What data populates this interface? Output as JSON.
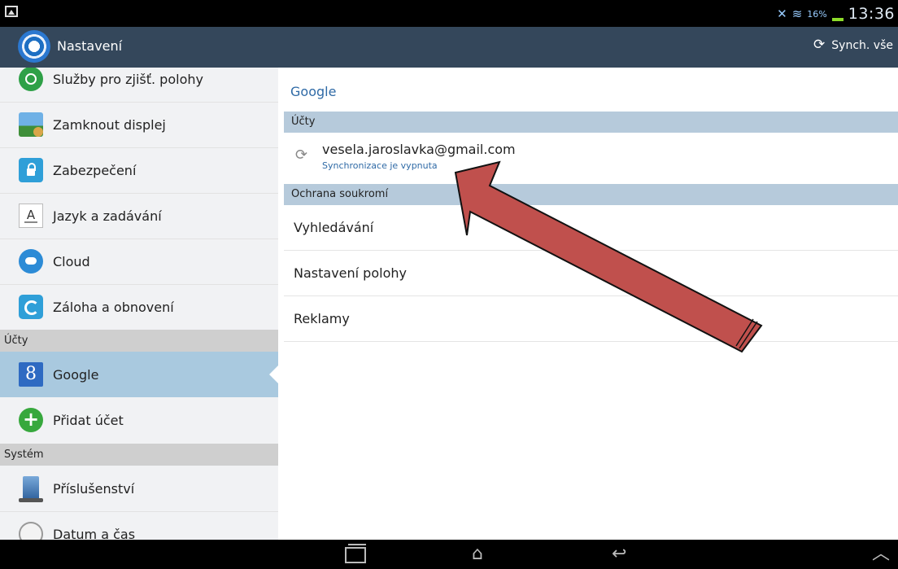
{
  "status_bar": {
    "battery_percent": "16%",
    "time": "13:36"
  },
  "action_bar": {
    "title": "Nastavení",
    "sync_all_label": "Synch. vše"
  },
  "sidebar": {
    "items_top": [
      {
        "label": "Služby pro zjišť. polohy",
        "icon": "location-icon"
      },
      {
        "label": "Zamknout displej",
        "icon": "lock-screen-icon"
      },
      {
        "label": "Zabezpečení",
        "icon": "padlock-icon"
      },
      {
        "label": "Jazyk a zadávání",
        "icon": "keyboard-language-icon"
      },
      {
        "label": "Cloud",
        "icon": "cloud-icon"
      },
      {
        "label": "Záloha a obnovení",
        "icon": "backup-restore-icon"
      }
    ],
    "accounts_header": "Účty",
    "accounts": [
      {
        "label": "Google",
        "icon": "google-icon",
        "active": true
      },
      {
        "label": "Přidat účet",
        "icon": "add-icon"
      }
    ],
    "system_header": "Systém",
    "system": [
      {
        "label": "Příslušenství",
        "icon": "accessory-icon"
      },
      {
        "label": "Datum a čas",
        "icon": "clock-icon"
      }
    ]
  },
  "content": {
    "title": "Google",
    "accounts_header": "Účty",
    "account": {
      "email": "vesela.jaroslavka@gmail.com",
      "status": "Synchronizace je vypnuta"
    },
    "privacy_header": "Ochrana soukromí",
    "privacy_items": [
      "Vyhledávání",
      "Nastavení polohy",
      "Reklamy"
    ]
  },
  "colors": {
    "action_bar": "#34475b",
    "active_item": "#a9c9df",
    "section_header": "#b6cadb",
    "accent_text": "#2f6aa6",
    "annotation_arrow": "#c0504d"
  }
}
